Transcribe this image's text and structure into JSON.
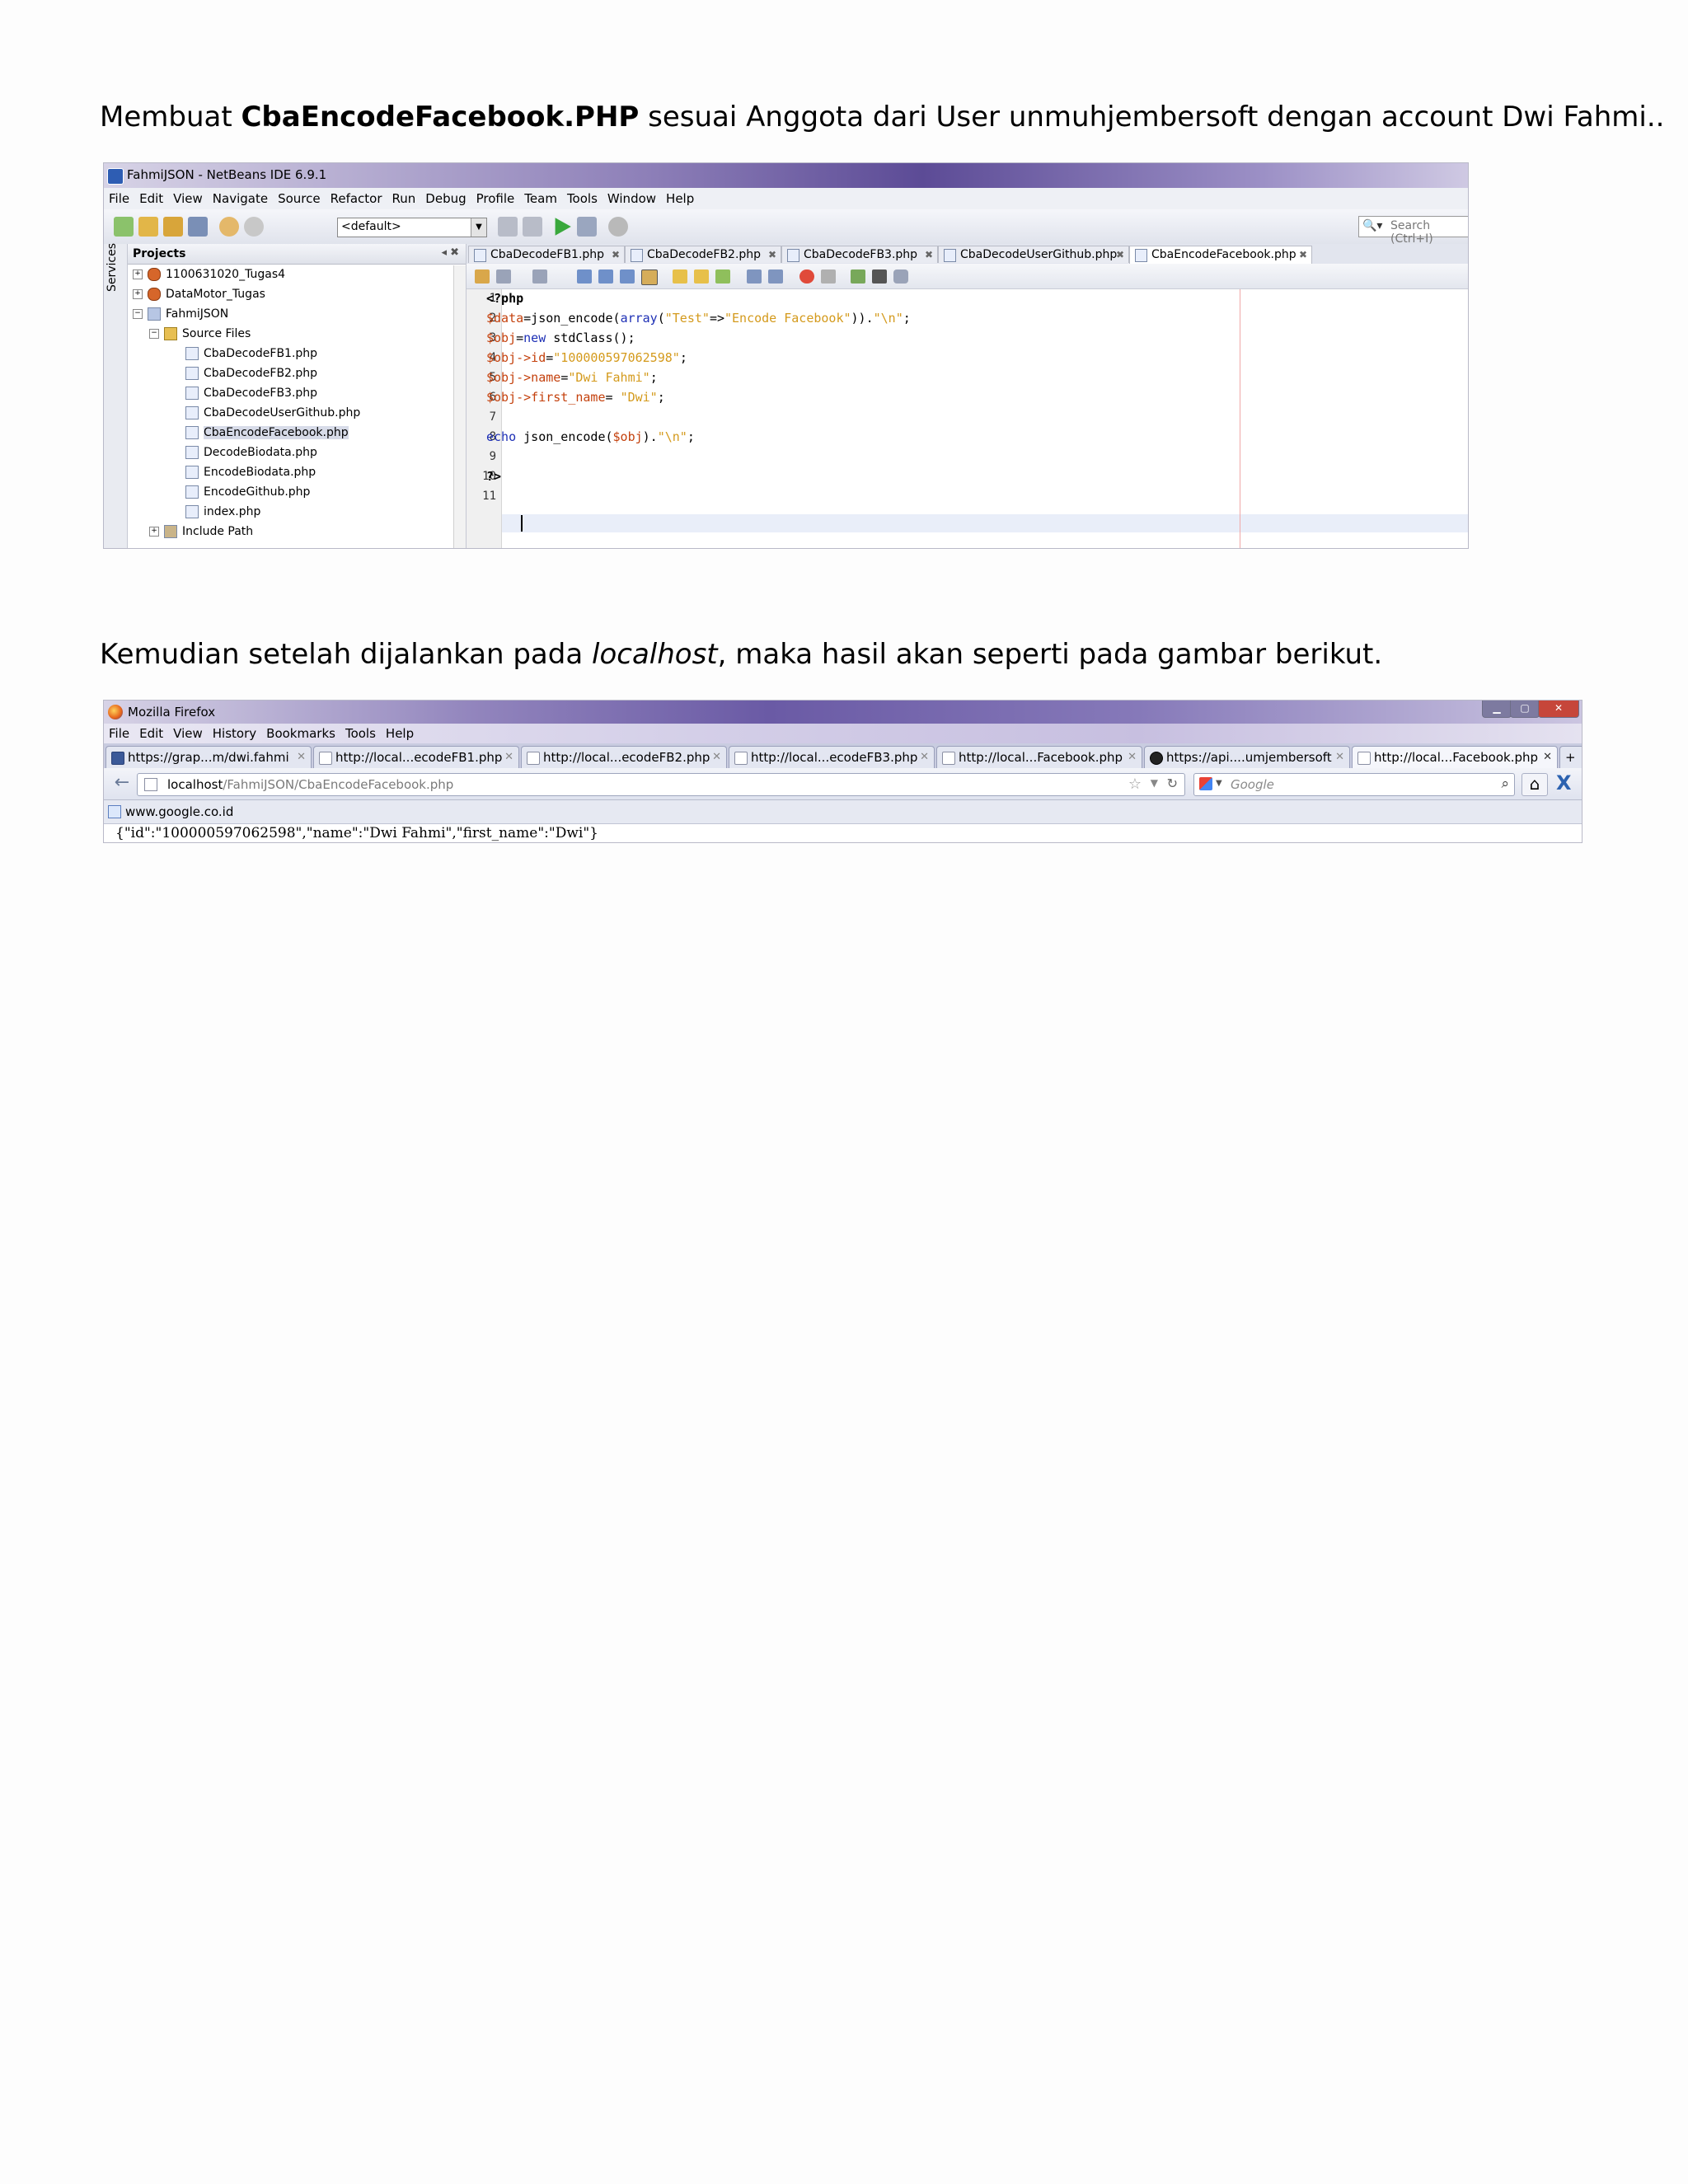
{
  "para1": {
    "prefix": "Membuat ",
    "bold": "CbaEncodeFacebook.PHP",
    "suffix": " sesuai Anggota dari User unmuhjembersoft dengan account Dwi Fahmi.."
  },
  "netbeans": {
    "title": "FahmiJSON - NetBeans IDE 6.9.1",
    "menu": [
      "File",
      "Edit",
      "View",
      "Navigate",
      "Source",
      "Refactor",
      "Run",
      "Debug",
      "Profile",
      "Team",
      "Tools",
      "Window",
      "Help"
    ],
    "config_combo": "<default>",
    "search_placeholder": "Search (Ctrl+I)",
    "services_label": "Services",
    "projects_header": "Projects",
    "tree": [
      "1100631020_Tugas4",
      "DataMotor_Tugas",
      "FahmiJSON",
      "Source Files",
      "CbaDecodeFB1.php",
      "CbaDecodeFB2.php",
      "CbaDecodeFB3.php",
      "CbaDecodeUserGithub.php",
      "CbaEncodeFacebook.php",
      "DecodeBiodata.php",
      "EncodeBiodata.php",
      "EncodeGithub.php",
      "index.php",
      "Include Path"
    ],
    "tabs": [
      "CbaDecodeFB1.php",
      "CbaDecodeFB2.php",
      "CbaDecodeFB3.php",
      "CbaDecodeUserGithub.php",
      "CbaEncodeFacebook.php"
    ],
    "line_numbers": [
      "1",
      "2",
      "3",
      "4",
      "5",
      "6",
      "7",
      "8",
      "9",
      "10",
      "11"
    ],
    "code": {
      "l1": "<?php",
      "l2_var": "$data",
      "l2_a": "=json_encode(",
      "l2_kw": "array",
      "l2_b": "(",
      "l2_s1": "\"Test\"",
      "l2_c": "=>",
      "l2_s2": "\"Encode Facebook\"",
      "l2_d": ")).",
      "l2_s3": "\"\\n\"",
      "l2_e": ";",
      "l3_var": "$obj",
      "l3_a": "=",
      "l3_kw": "new",
      "l3_b": " stdClass();",
      "l4_var": "$obj->id",
      "l4_a": "=",
      "l4_s": "\"100000597062598\"",
      "l4_b": ";",
      "l5_var": "$obj->name",
      "l5_a": "=",
      "l5_s": "\"Dwi Fahmi\"",
      "l5_b": ";",
      "l6_var": "$obj->first_name",
      "l6_a": "= ",
      "l6_s": "\"Dwi\"",
      "l6_b": ";",
      "l8_kw": "echo",
      "l8_a": " json_encode(",
      "l8_var": "$obj",
      "l8_b": ").",
      "l8_s": "\"\\n\"",
      "l8_c": ";",
      "l10": "?>"
    }
  },
  "para2": {
    "prefix": "Kemudian setelah dijalankan pada ",
    "italic": "localhost",
    "suffix": ", maka hasil akan seperti pada gambar berikut."
  },
  "firefox": {
    "title": "Mozilla Firefox",
    "menu": [
      "File",
      "Edit",
      "View",
      "History",
      "Bookmarks",
      "Tools",
      "Help"
    ],
    "tabs": [
      "https://grap...m/dwi.fahmi",
      "http://local...ecodeFB1.php",
      "http://local...ecodeFB2.php",
      "http://local...ecodeFB3.php",
      "http://local...Facebook.php",
      "https://api....umjembersoft",
      "http://local...Facebook.php"
    ],
    "url_host": "localhost",
    "url_path": "/FahmiJSON/CbaEncodeFacebook.php",
    "search_placeholder": "Google",
    "bookmark": "www.google.co.id",
    "output": "{\"id\":\"100000597062598\",\"name\":\"Dwi Fahmi\",\"first_name\":\"Dwi\"}"
  }
}
